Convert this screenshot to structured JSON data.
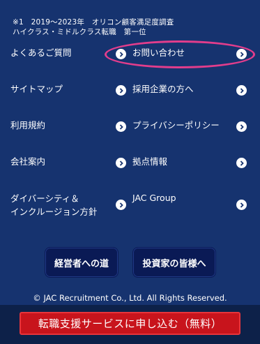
{
  "note": "※1　2019〜2023年　オリコン顧客満足度調査\nハイクラス・ミドルクラス転職　第一位",
  "links": [
    {
      "label": "よくあるご質問"
    },
    {
      "label": "お問い合わせ"
    },
    {
      "label": "サイトマップ"
    },
    {
      "label": "採用企業の方へ"
    },
    {
      "label": "利用規約"
    },
    {
      "label": "プライバシーポリシー"
    },
    {
      "label": "会社案内"
    },
    {
      "label": "拠点情報"
    },
    {
      "label": "ダイバーシティ＆\nインクルージョン方針"
    },
    {
      "label": "JAC Group"
    }
  ],
  "buttons": {
    "executive": "経営者への道",
    "investor": "投資家の皆様へ"
  },
  "copyright": "© JAC Recruitment Co., Ltd. All Rights Reserved.",
  "cta": "転職支援サービスに申し込む（無料）",
  "colors": {
    "background": "#16336f",
    "highlight": "#e23d8c",
    "cta": "#c8141c"
  },
  "icons": {
    "arrow": "chevron-right-circle-icon"
  }
}
